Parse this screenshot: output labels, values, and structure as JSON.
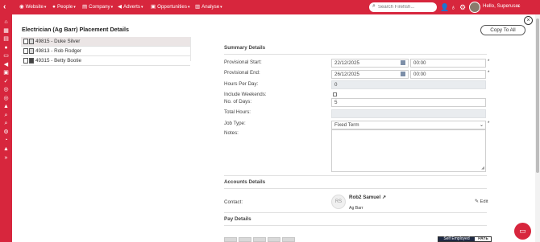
{
  "nav": {
    "back_icon": "chevron-left-icon",
    "items": [
      {
        "label": "Website",
        "icon": "globe-icon"
      },
      {
        "label": "People",
        "icon": "person-icon"
      },
      {
        "label": "Company",
        "icon": "building-icon"
      },
      {
        "label": "Adverts",
        "icon": "megaphone-icon"
      },
      {
        "label": "Opportunities",
        "icon": "briefcase-icon"
      },
      {
        "label": "Analyse",
        "icon": "chart-icon"
      }
    ],
    "search_placeholder": "Search Firefish...",
    "greeting": "Hello, Superuser",
    "brand_color": "#d7263d"
  },
  "page": {
    "title": "Electrician (Ag Barr) Placement Details",
    "copy_button": "Copy To All",
    "placements": [
      {
        "label": "49815 - Duke Silver",
        "selected": true
      },
      {
        "label": "49813 - Rob Rodger",
        "selected": false
      },
      {
        "label": "49315 - Betty Bootie",
        "selected": false
      }
    ]
  },
  "summary": {
    "heading": "Summary Details",
    "provisional_start_label": "Provisional Start:",
    "provisional_start_date": "22/12/2025",
    "provisional_start_time": "00:00",
    "provisional_end_label": "Provisional End:",
    "provisional_end_date": "26/12/2025",
    "provisional_end_time": "00:00",
    "hours_per_day_label": "Hours Per Day:",
    "hours_per_day": "0",
    "include_weekends_label": "Include Weekends:",
    "include_weekends_checked": false,
    "no_of_days_label": "No. of Days:",
    "no_of_days": "5",
    "total_hours_label": "Total Hours:",
    "total_hours": "",
    "job_type_label": "Job Type:",
    "job_type": "Fixed Term",
    "notes_label": "Notes:",
    "notes": "",
    "required_mark": "*"
  },
  "accounts": {
    "heading": "Accounts Details",
    "contact_label": "Contact:",
    "contact_initials": "RS",
    "contact_name": "Rob2 Samuel",
    "contact_company": "Ag Barr",
    "edit_label": "Edit"
  },
  "pay": {
    "heading": "Pay Details",
    "toggle_on": "Self Employed",
    "toggle_off": "PAYE"
  }
}
